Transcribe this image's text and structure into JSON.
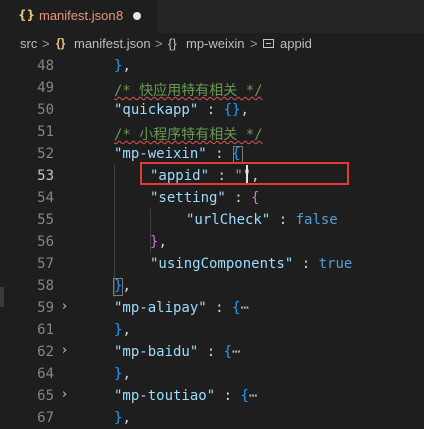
{
  "tab": {
    "icon": "{}",
    "filename": "manifest.json",
    "problem_count": "8",
    "dirty_indicator": "unsaved-dot"
  },
  "breadcrumb": {
    "items": [
      "src",
      "manifest.json",
      "mp-weixin",
      "appid"
    ],
    "separator": ">",
    "icons": [
      "braces-icon",
      "braces-icon",
      "property-icon"
    ]
  },
  "editor": {
    "active_line": "53",
    "lines": [
      {
        "num": "48",
        "text": "},"
      },
      {
        "num": "49",
        "text": "/* 快应用特有相关 */"
      },
      {
        "num": "50",
        "text": "\"quickapp\" : {},"
      },
      {
        "num": "51",
        "text": "/* 小程序特有相关 */"
      },
      {
        "num": "52",
        "text": "\"mp-weixin\" : {"
      },
      {
        "num": "53",
        "text": "\"appid\" : \"\","
      },
      {
        "num": "54",
        "text": "\"setting\" : {"
      },
      {
        "num": "55",
        "text": "\"urlCheck\" : false"
      },
      {
        "num": "56",
        "text": "},"
      },
      {
        "num": "57",
        "text": "\"usingComponents\" : true"
      },
      {
        "num": "58",
        "text": "},"
      },
      {
        "num": "59",
        "text": "\"mp-alipay\" : {⋯",
        "folded": true
      },
      {
        "num": "61",
        "text": "},"
      },
      {
        "num": "62",
        "text": "\"mp-baidu\" : {⋯",
        "folded": true
      },
      {
        "num": "64",
        "text": "},"
      },
      {
        "num": "65",
        "text": "\"mp-toutiao\" : {⋯",
        "folded": true
      },
      {
        "num": "67",
        "text": "},"
      }
    ]
  },
  "colors": {
    "background": "#1e1e1e",
    "key": "#9cdcfe",
    "string": "#ce9178",
    "keyword": "#569cd6",
    "comment": "#6a9955",
    "highlight": "#e53935"
  }
}
